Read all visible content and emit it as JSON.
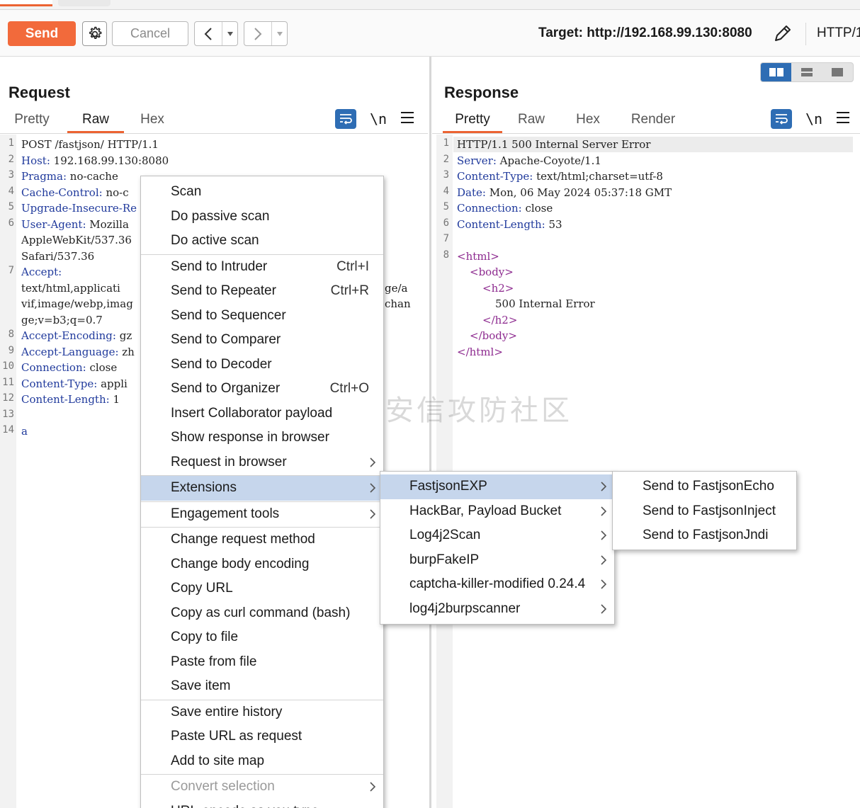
{
  "toolbar": {
    "send_label": "Send",
    "cancel_label": "Cancel",
    "target_label": "Target: http://192.168.99.130:8080",
    "http_version": "HTTP/1"
  },
  "request": {
    "title": "Request",
    "tabs": [
      "Pretty",
      "Raw",
      "Hex"
    ],
    "active_tab": "Raw",
    "newline_label": "\\n",
    "lines": [
      {
        "n": "1",
        "key": "",
        "val": "POST /fastjson/ HTTP/1.1"
      },
      {
        "n": "2",
        "key": "Host:",
        "val": " 192.168.99.130:8080"
      },
      {
        "n": "3",
        "key": "Pragma:",
        "val": " no-cache"
      },
      {
        "n": "4",
        "key": "Cache-Control:",
        "val": " no-c"
      },
      {
        "n": "5",
        "key": "Upgrade-Insecure-Re",
        "val": ""
      },
      {
        "n": "6",
        "key": "User-Agent:",
        "val": " Mozilla"
      },
      {
        "n": "",
        "key": "",
        "val": "AppleWebKit/537.36"
      },
      {
        "n": "",
        "key": "",
        "val": "Safari/537.36"
      },
      {
        "n": "7",
        "key": "Accept:",
        "val": ""
      },
      {
        "n": "",
        "key": "",
        "val": "text/html,applicati"
      },
      {
        "n": "",
        "key": "",
        "val": "vif,image/webp,imag"
      },
      {
        "n": "",
        "key": "",
        "val": "ge;v=b3;q=0.7"
      },
      {
        "n": "8",
        "key": "Accept-Encoding:",
        "val": " gz"
      },
      {
        "n": "9",
        "key": "Accept-Language:",
        "val": " zh"
      },
      {
        "n": "10",
        "key": "Connection:",
        "val": " close"
      },
      {
        "n": "11",
        "key": "Content-Type:",
        "val": " appli"
      },
      {
        "n": "12",
        "key": "Content-Length:",
        "val": " 1"
      },
      {
        "n": "13",
        "key": "",
        "val": ""
      },
      {
        "n": "14",
        "key": "a",
        "val": ""
      }
    ],
    "overflow_fragments": [
      "ge/a",
      "chan"
    ]
  },
  "response": {
    "title": "Response",
    "tabs": [
      "Pretty",
      "Raw",
      "Hex",
      "Render"
    ],
    "active_tab": "Pretty",
    "newline_label": "\\n",
    "lines": [
      {
        "n": "1",
        "key": "",
        "val": "HTTP/1.1 500 Internal Server Error",
        "indent": 0
      },
      {
        "n": "2",
        "key": "Server:",
        "val": " Apache-Coyote/1.1",
        "indent": 0
      },
      {
        "n": "3",
        "key": "Content-Type:",
        "val": " text/html;charset=utf-8",
        "indent": 0
      },
      {
        "n": "4",
        "key": "Date:",
        "val": " Mon, 06 May 2024 05:37:18 GMT",
        "indent": 0
      },
      {
        "n": "5",
        "key": "Connection:",
        "val": " close",
        "indent": 0
      },
      {
        "n": "6",
        "key": "Content-Length:",
        "val": " 53",
        "indent": 0
      },
      {
        "n": "7",
        "key": "",
        "val": "",
        "indent": 0
      },
      {
        "n": "8",
        "tag": "<html>",
        "indent": 0
      },
      {
        "n": "",
        "tag": "<body>",
        "indent": 1
      },
      {
        "n": "",
        "tag": "<h2>",
        "indent": 2
      },
      {
        "n": "",
        "key": "",
        "val": "500 Internal Error",
        "indent": 3
      },
      {
        "n": "",
        "tag": "</h2>",
        "indent": 2
      },
      {
        "n": "",
        "tag": "</body>",
        "indent": 1
      },
      {
        "n": "",
        "tag": "</html>",
        "indent": 0
      }
    ]
  },
  "context_menu": {
    "items": [
      {
        "label": "Scan"
      },
      {
        "label": "Do passive scan"
      },
      {
        "label": "Do active scan",
        "sep_after": true
      },
      {
        "label": "Send to Intruder",
        "shortcut": "Ctrl+I"
      },
      {
        "label": "Send to Repeater",
        "shortcut": "Ctrl+R"
      },
      {
        "label": "Send to Sequencer"
      },
      {
        "label": "Send to Comparer"
      },
      {
        "label": "Send to Decoder"
      },
      {
        "label": "Send to Organizer",
        "shortcut": "Ctrl+O"
      },
      {
        "label": "Insert Collaborator payload"
      },
      {
        "label": "Show response in browser"
      },
      {
        "label": "Request in browser",
        "submenu": true,
        "sep_after": true
      },
      {
        "label": "Extensions",
        "submenu": true,
        "selected": true,
        "sep_after": true
      },
      {
        "label": "Engagement tools",
        "submenu": true,
        "sep_after": true
      },
      {
        "label": "Change request method"
      },
      {
        "label": "Change body encoding"
      },
      {
        "label": "Copy URL"
      },
      {
        "label": "Copy as curl command (bash)"
      },
      {
        "label": "Copy to file"
      },
      {
        "label": "Paste from file"
      },
      {
        "label": "Save item",
        "sep_after": true
      },
      {
        "label": "Save entire history"
      },
      {
        "label": "Paste URL as request"
      },
      {
        "label": "Add to site map",
        "sep_after": true
      },
      {
        "label": "Convert selection",
        "submenu": true,
        "disabled": true
      },
      {
        "label": "URL-encode as you type"
      }
    ]
  },
  "extensions_menu": {
    "items": [
      {
        "label": "FastjsonEXP",
        "selected": true
      },
      {
        "label": "HackBar, Payload Bucket"
      },
      {
        "label": "Log4j2Scan"
      },
      {
        "label": "burpFakeIP"
      },
      {
        "label": "captcha-killer-modified 0.24.4"
      },
      {
        "label": "log4j2burpscanner"
      }
    ]
  },
  "fastjson_menu": {
    "items": [
      {
        "label": "Send to FastjsonEcho"
      },
      {
        "label": "Send to FastjsonInject"
      },
      {
        "label": "Send to FastjsonJndi"
      }
    ]
  },
  "watermark": {
    "text": "奇安信攻防社区"
  },
  "colors": {
    "accent": "#f26a3b",
    "selection": "#c6d6ec",
    "primary_blue": "#2e6db4",
    "header_key": "#203a9c",
    "html_tag": "#8d2a8f"
  }
}
